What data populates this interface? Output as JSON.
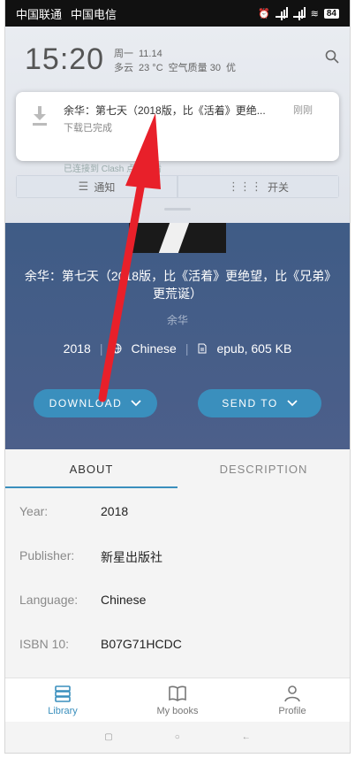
{
  "status_bar": {
    "carrier1": "中国联通",
    "carrier2": "中国电信",
    "battery": "84"
  },
  "shade": {
    "time": "15:20",
    "weekday": "周一",
    "date": "11.14",
    "weather": "多云",
    "temperature": "23 °C",
    "air": "空气质量 30",
    "air_level": "优",
    "notification": {
      "title": "余华：第七天（2018版，比《活着》更绝...",
      "time": "刚刚",
      "subtitle": "下载已完成"
    },
    "under_text": "已连接到 Clash   点击查看",
    "tab_notify": "通知",
    "tab_switch": "开关"
  },
  "book": {
    "title": "余华：第七天（2018版，比《活着》更绝望，比《兄弟》更荒诞）",
    "author": "余华",
    "year": "2018",
    "language": "Chinese",
    "format": "epub, 605 KB",
    "download_label": "DOWNLOAD",
    "send_label": "SEND TO"
  },
  "details": {
    "tab_about": "ABOUT",
    "tab_description": "DESCRIPTION",
    "rows": [
      {
        "label": "Year:",
        "value": "2018"
      },
      {
        "label": "Publisher:",
        "value": "新星出版社"
      },
      {
        "label": "Language:",
        "value": "Chinese"
      },
      {
        "label": "ISBN 10:",
        "value": "B07G71HCDC"
      }
    ]
  },
  "bottom_nav": {
    "library": "Library",
    "my_books": "My books",
    "profile": "Profile"
  },
  "colors": {
    "accent": "#3a8fbd",
    "hero": "#435d88",
    "arrow": "#e8202a"
  }
}
